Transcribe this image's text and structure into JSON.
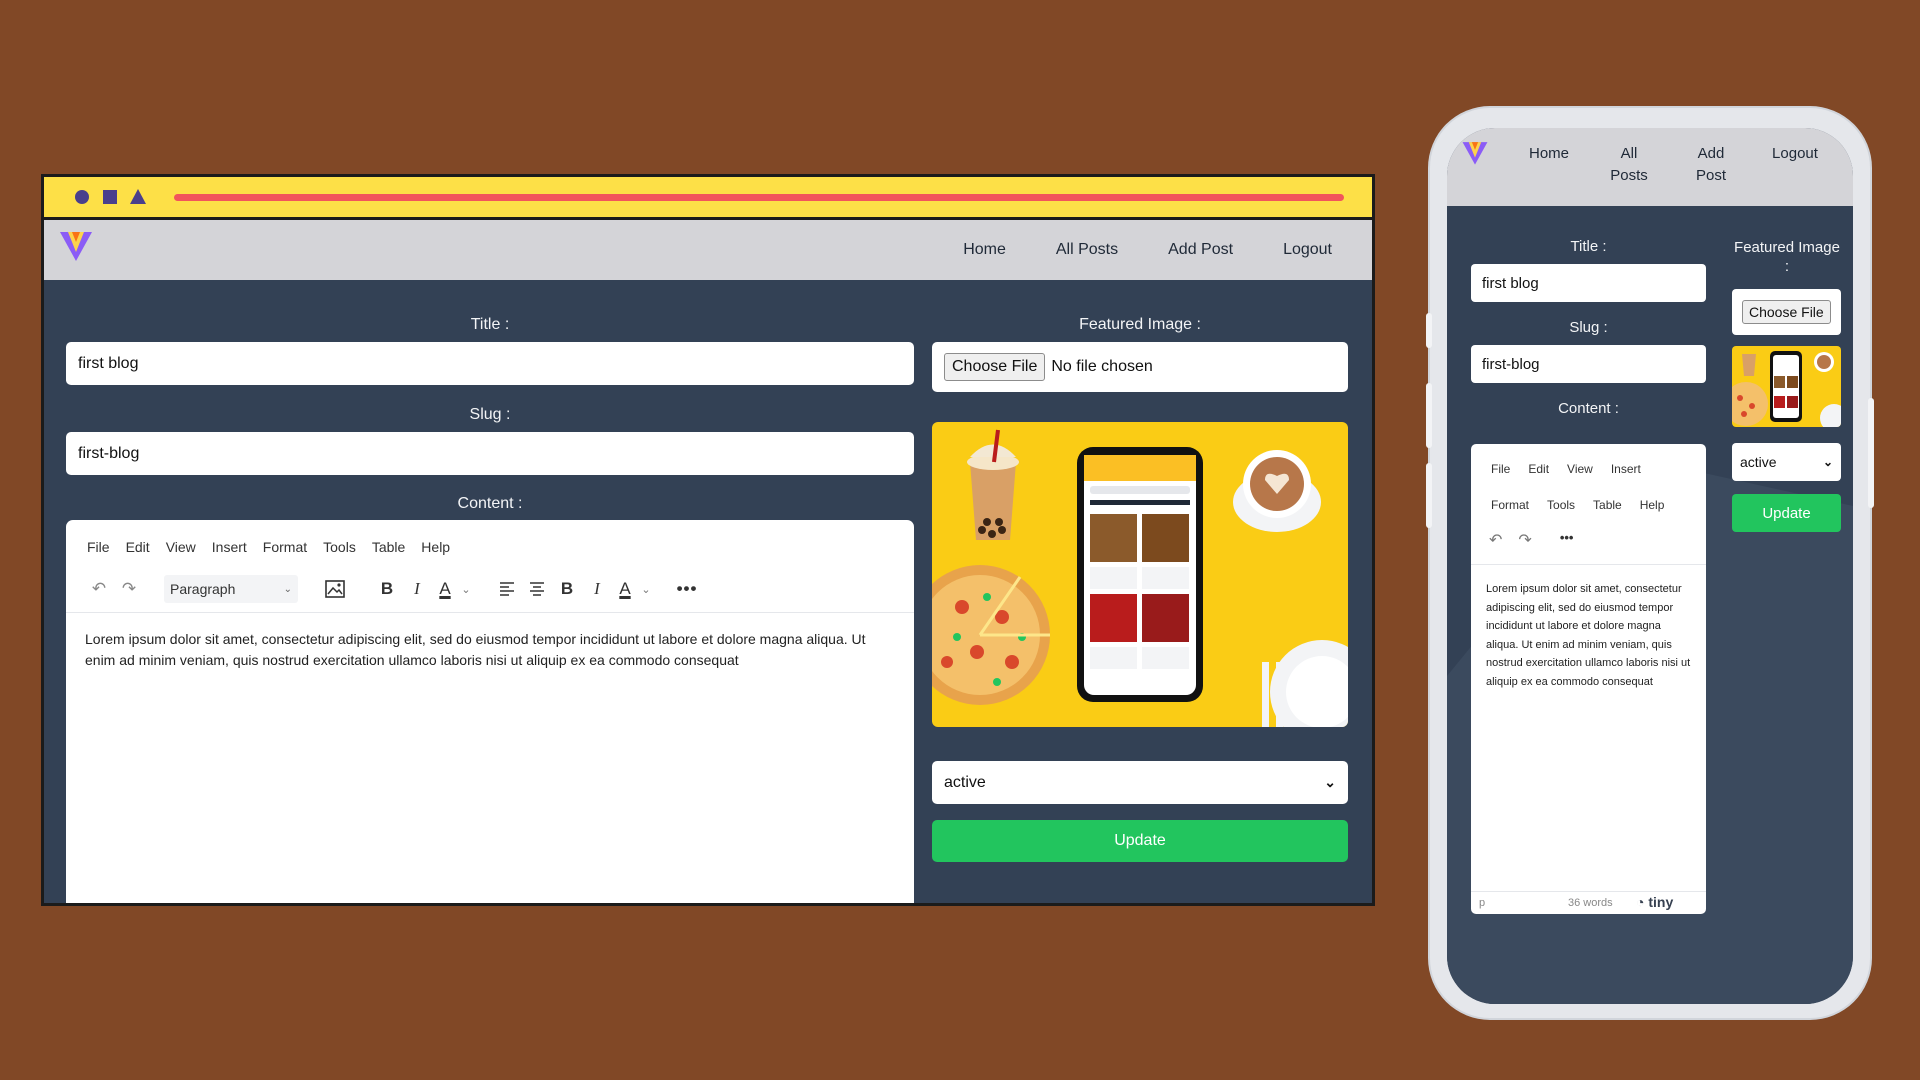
{
  "colors": {
    "background": "#814826",
    "browser_bar": "#fde047",
    "url_bar": "#f2555b",
    "navbar": "#d4d4d8",
    "page": "#334155",
    "update_button": "#22c55e",
    "image_bg": "#facc15"
  },
  "nav": {
    "home": "Home",
    "all_posts": "All Posts",
    "add_post": "Add Post",
    "logout": "Logout",
    "mobile_all": "All",
    "mobile_posts": "Posts",
    "mobile_add": "Add",
    "mobile_post": "Post"
  },
  "form": {
    "title_label": "Title :",
    "title_value": "first blog",
    "slug_label": "Slug :",
    "slug_value": "first-blog",
    "content_label": "Content :",
    "featured_label": "Featured Image :",
    "mobile_featured_label": "Featured Image",
    "mobile_featured_colon": ":",
    "choose_file": "Choose File",
    "no_file": "No file chosen",
    "status_value": "active",
    "update_label": "Update"
  },
  "editor": {
    "menu": [
      "File",
      "Edit",
      "View",
      "Insert",
      "Format",
      "Tools",
      "Table",
      "Help"
    ],
    "block_format": "Paragraph",
    "body_text": "Lorem ipsum dolor sit amet, consectetur adipiscing elit, sed do eiusmod tempor incididunt ut labore et dolore magna aliqua. Ut enim ad minim veniam, quis nostrud exercitation ullamco laboris nisi ut aliquip ex ea commodo consequat",
    "status_path": "p",
    "word_count": "36 words",
    "brand": "tiny",
    "icons": [
      "undo-icon",
      "redo-icon",
      "image-icon",
      "bold-icon",
      "italic-icon",
      "text-color-icon",
      "align-left-icon",
      "align-center-icon",
      "more-icon"
    ]
  }
}
